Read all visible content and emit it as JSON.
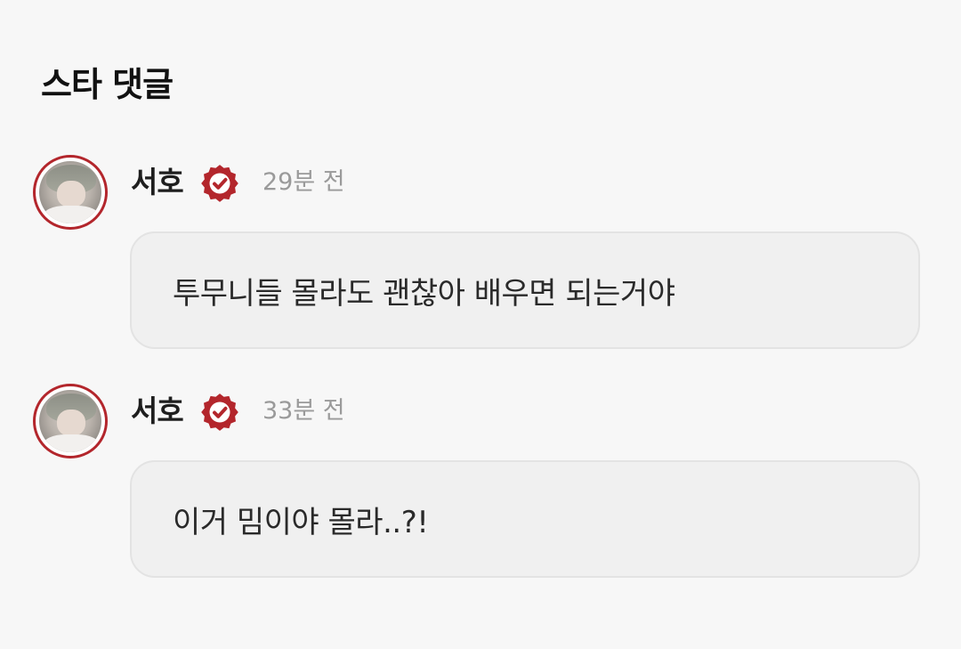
{
  "section": {
    "title": "스타 댓글"
  },
  "comments": [
    {
      "author": "서호",
      "verified_icon": "verified-badge-icon",
      "time": "29분 전",
      "text": "투무니들 몰라도 괜찮아 배우면 되는거야"
    },
    {
      "author": "서호",
      "verified_icon": "verified-badge-icon",
      "time": "33분 전",
      "text": "이거 밈이야 몰라..?!"
    }
  ],
  "colors": {
    "background": "#f7f7f7",
    "accent": "#b3262c",
    "bubble": "#f0f0f0",
    "bubble_border": "#e3e3e3",
    "muted_text": "#9a9a9a"
  }
}
